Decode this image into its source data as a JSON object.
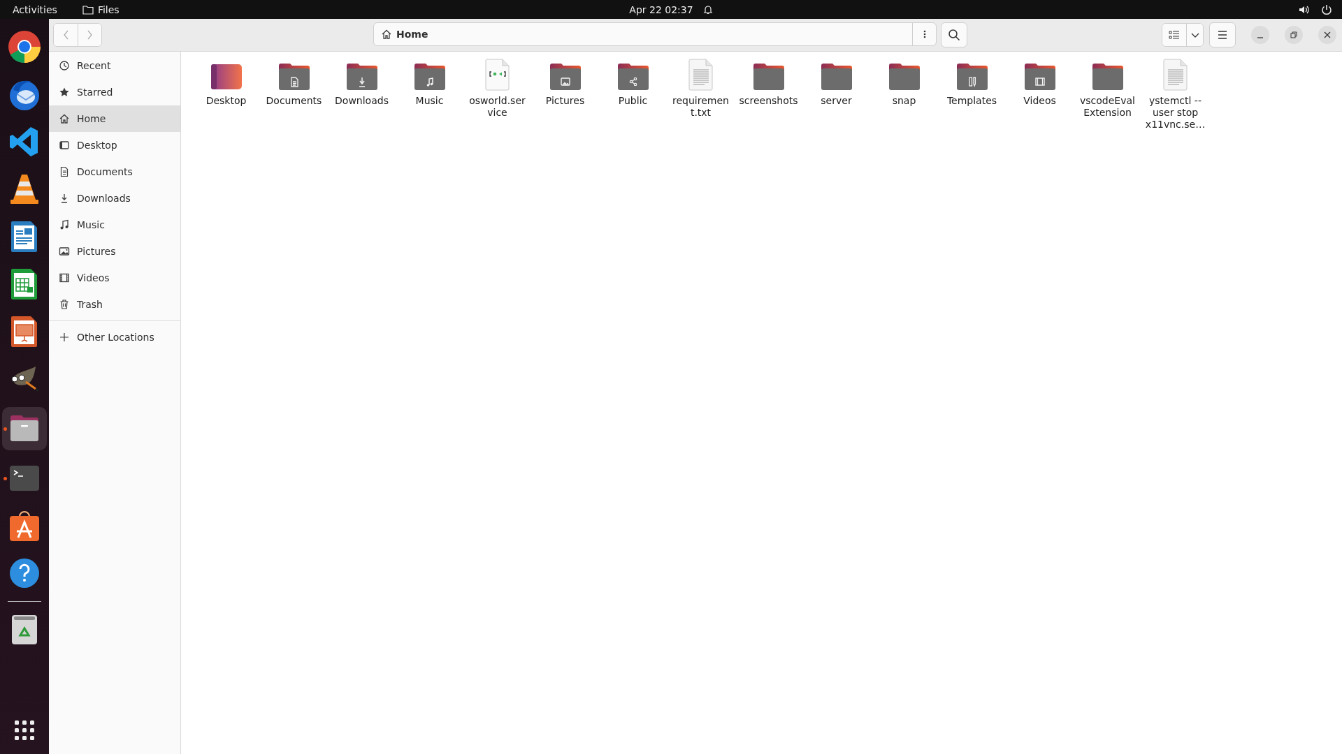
{
  "top_bar": {
    "activities": "Activities",
    "app_name": "Files",
    "clock": "Apr 22  02:37"
  },
  "dock": {
    "items": [
      {
        "kind": "chrome",
        "running": false,
        "selected": false
      },
      {
        "kind": "thunderbird",
        "running": false,
        "selected": false
      },
      {
        "kind": "vscode",
        "running": false,
        "selected": false
      },
      {
        "kind": "vlc",
        "running": false,
        "selected": false
      },
      {
        "kind": "writer",
        "running": false,
        "selected": false
      },
      {
        "kind": "calc",
        "running": false,
        "selected": false
      },
      {
        "kind": "impress",
        "running": false,
        "selected": false
      },
      {
        "kind": "gimp",
        "running": false,
        "selected": false
      },
      {
        "kind": "files",
        "running": true,
        "selected": true
      },
      {
        "kind": "terminal",
        "running": true,
        "selected": false
      },
      {
        "kind": "store",
        "running": false,
        "selected": false
      },
      {
        "kind": "help",
        "running": false,
        "selected": false
      },
      {
        "kind": "trash",
        "running": false,
        "selected": false
      }
    ]
  },
  "header": {
    "path": "Home"
  },
  "sidebar": {
    "items": [
      {
        "label": "Recent",
        "selected": false
      },
      {
        "label": "Starred",
        "selected": false
      },
      {
        "label": "Home",
        "selected": true
      },
      {
        "label": "Desktop",
        "selected": false
      },
      {
        "label": "Documents",
        "selected": false
      },
      {
        "label": "Downloads",
        "selected": false
      },
      {
        "label": "Music",
        "selected": false
      },
      {
        "label": "Pictures",
        "selected": false
      },
      {
        "label": "Videos",
        "selected": false
      },
      {
        "label": "Trash",
        "selected": false
      }
    ],
    "other": {
      "label": "Other Locations"
    }
  },
  "files": [
    {
      "name": "Desktop",
      "kind": "desktop"
    },
    {
      "name": "Documents",
      "kind": "documents"
    },
    {
      "name": "Downloads",
      "kind": "downloads"
    },
    {
      "name": "Music",
      "kind": "music"
    },
    {
      "name": "osworld.service",
      "kind": "service"
    },
    {
      "name": "Pictures",
      "kind": "pictures"
    },
    {
      "name": "Public",
      "kind": "public"
    },
    {
      "name": "requirement.txt",
      "kind": "text"
    },
    {
      "name": "screenshots",
      "kind": "folder"
    },
    {
      "name": "server",
      "kind": "folder"
    },
    {
      "name": "snap",
      "kind": "folder"
    },
    {
      "name": "Templates",
      "kind": "templates"
    },
    {
      "name": "Videos",
      "kind": "videos"
    },
    {
      "name": "vscodeEvalExtension",
      "kind": "folder"
    },
    {
      "name": "ystemctl --user stop x11vnc.se…",
      "kind": "text"
    }
  ]
}
